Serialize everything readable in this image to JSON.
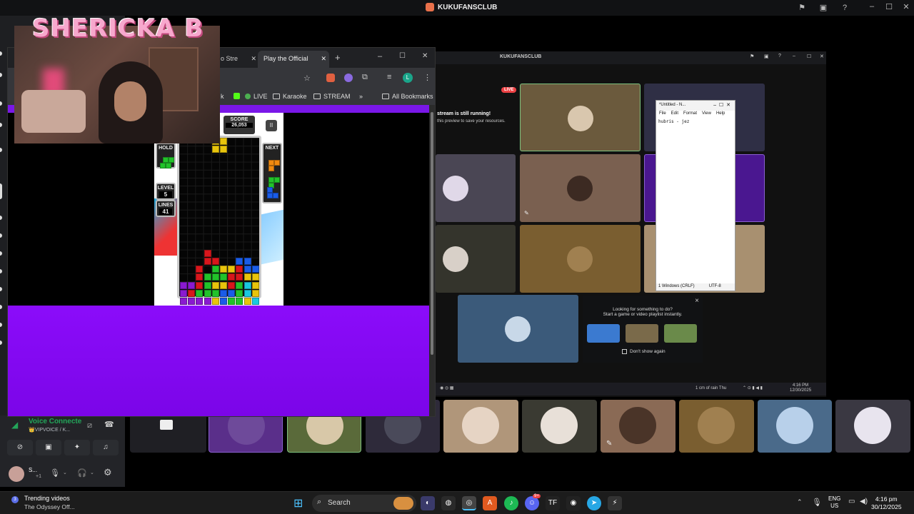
{
  "app_title": "KUKUFANSCLUB",
  "streamer_name": "SHERICKA B",
  "chrome": {
    "tabs": [
      {
        "label": "o Stre",
        "active": false
      },
      {
        "label": "Play the Official",
        "active": true
      }
    ],
    "new_tab": "+",
    "bookmarks": [
      {
        "label": "k"
      },
      {
        "label": "LIVE"
      },
      {
        "label": "Karaoke"
      },
      {
        "label": "STREAM"
      }
    ],
    "more_bookmarks": "»",
    "all_bookmarks": "All Bookmarks",
    "profile_letter": "L"
  },
  "tetris": {
    "score_label": "SCORE",
    "score_value": "26,053",
    "hold_label": "HOLD",
    "next_label": "NEXT",
    "level_label": "LEVEL",
    "level_value": "5",
    "lines_label": "LINES",
    "lines_value": "41",
    "pause_icon": "II"
  },
  "stream": {
    "title": "KUKUFANSCLUB",
    "live_badge": "LIVE",
    "still_running": "stream is still running!",
    "still_sub": "this preview to save your resources."
  },
  "notepad": {
    "title": "*Untitled - N...",
    "menu": [
      "File",
      "Edit",
      "Format",
      "View",
      "Help"
    ],
    "content": "hubris - jez",
    "status_left": "1 Windows (CRLF)",
    "status_right": "UTF-8"
  },
  "suggest": {
    "line1": "Looking for something to do?",
    "line2": "Start a game or video playlist instantly.",
    "dont_show": "Don't show again",
    "close": "×"
  },
  "inner_taskbar": {
    "weather": "1 cm of rain Thu",
    "time": "4:16 PM",
    "date": "12/30/2025"
  },
  "voice": {
    "connected": "Voice Connecte",
    "channel": "👑VIPVOICE / K...",
    "username": "S...",
    "badge": "+1"
  },
  "taskbar": {
    "news_title": "Trending videos",
    "news_sub": "The Odyssey Off...",
    "news_badge": "3",
    "search_label": "Search",
    "lang_top": "ENG",
    "lang_bottom": "US",
    "time": "4:16 pm",
    "date": "30/12/2025",
    "discord_badge": "9+"
  },
  "colors": {
    "accent_purple": "#7b05e8",
    "discord_green": "#23a55a",
    "live_red": "#ed4245"
  }
}
